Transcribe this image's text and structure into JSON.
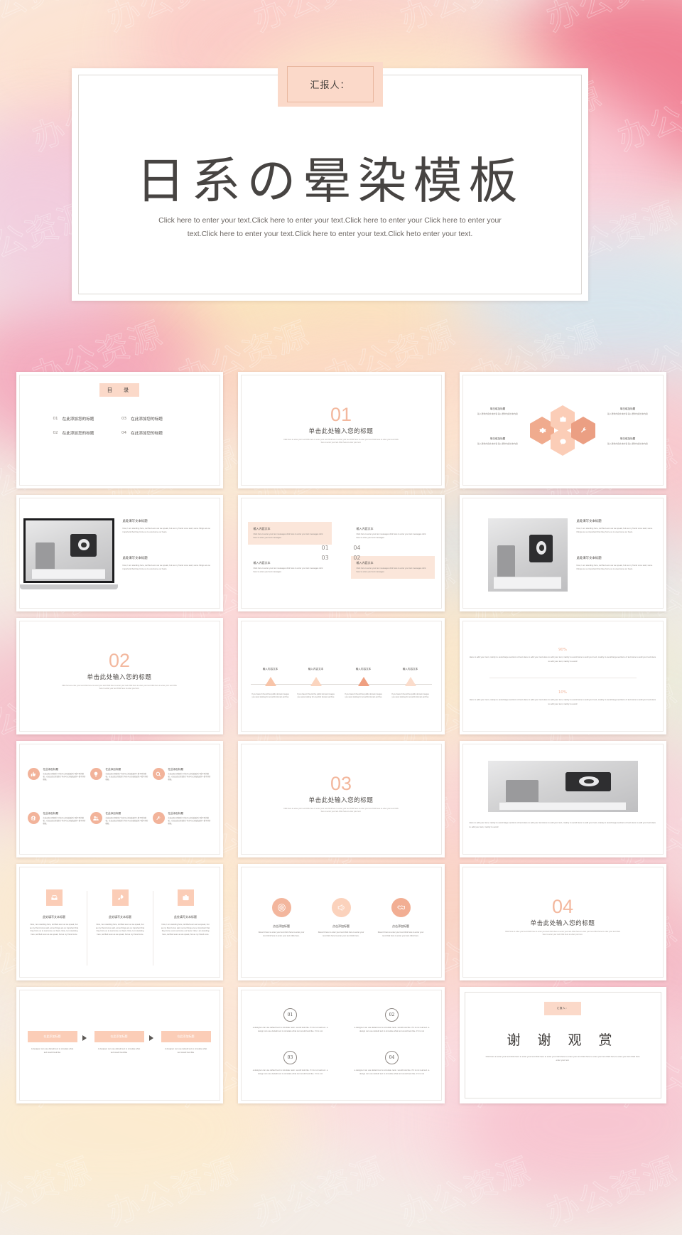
{
  "theme": {
    "accent": "#f0b49a",
    "accent_deep": "#eb9f83",
    "accent_soft": "#fbcdb7",
    "accent_pale": "#fbe6da",
    "badge_bg": "#fbd9c9",
    "text_dark": "#4c4845",
    "text_mid": "#8a8480",
    "slide_bg": "#ffffff"
  },
  "watermark": {
    "glyph": "办公资源"
  },
  "hero": {
    "badge": "汇报人：",
    "title": "日系の晕染模板",
    "subtitle": "Click here to enter your text.Click here to enter your text.Click here to enter your Click here to enter your text.Click here to enter your text.Click here to enter your text.Click heto enter your text."
  },
  "slides": {
    "toc": {
      "badge": "目　录",
      "items": [
        {
          "num": "01",
          "title": "在此添加您的标题"
        },
        {
          "num": "03",
          "title": "在此添加您的标题"
        },
        {
          "num": "02",
          "title": "在此添加您的标题"
        },
        {
          "num": "04",
          "title": "在此添加您的标题"
        }
      ]
    },
    "section_1": {
      "num": "01",
      "title": "单击此处输入您的标题",
      "desc": "Click here to enter your text.Click here to enter your text.Click here to enter your text.Click here to enter your text.Click here to enter your text.Click here to enter your text.Click here to enter your text."
    },
    "section_2": {
      "num": "02",
      "title": "单击此处输入您的标题",
      "desc": "Click here to enter your text.Click here to enter your text.Click here to enter your text.Click here to enter your text.Click here to enter your text.Click here to enter your text.Click here to enter your text."
    },
    "section_3": {
      "num": "03",
      "title": "单击此处输入您的标题",
      "desc": "Click here to enter your text.Click here to enter your text.Click here to enter your text.Click here to enter your text.Click here to enter your text.Click here to enter your text.Click here to enter your text."
    },
    "section_4": {
      "num": "04",
      "title": "单击此处输入您的标题",
      "desc": "Click here to enter your text.Click here to enter your text.Click here to enter your text.Click here to enter your text.Click here to enter your text.Click here to enter your text.Click here to enter your text."
    },
    "hexagon": {
      "labels": [
        {
          "title": "单击填加标题",
          "body": "输入整体内容文本内容 输入整体内容文本内容"
        },
        {
          "title": "单击填加标题",
          "body": "输入整体内容文本内容 输入整体内容文本内容"
        },
        {
          "title": "单击填加标题",
          "body": "输入整体内容文本内容 输入整体内容文本内容"
        },
        {
          "title": "单击填加标题",
          "body": "输入整体内容文本内容 输入整体内容文本内容"
        }
      ],
      "icons": [
        "briefcase-icon",
        "gear-icon",
        "wrench-icon",
        "chat-icon"
      ]
    },
    "laptop_photo": {
      "blocks": [
        {
          "title": "此处填写文本标题",
          "body": "Now, I am standing here, terrified even as we speak, but as my friend once said, some things are so important that they force us to overcome our fears."
        },
        {
          "title": "此处填写文本标题",
          "body": "Now, I am standing here, terrified even as we speak, but as my friend once said, some things are so important that they force us to overcome our fears."
        }
      ]
    },
    "camera_photo": {
      "blocks": [
        {
          "title": "此处填写文本标题",
          "body": "Now, I am standing here, terrified even as we speak, but as my friend once said, some things are so important that they force us to overcome our fears."
        },
        {
          "title": "此处填写文本标题",
          "body": "Now, I am standing here, terrified even as we speak, but as my friend once said, some things are so important that they force us to overcome our fears."
        }
      ]
    },
    "quadrants": {
      "items": [
        {
          "num": "01",
          "title": "输入内容文本",
          "body": "Click here to enter your text messages click here to enter your text messages click here to enter your text messages"
        },
        {
          "num": "04",
          "title": "输入内容文本",
          "body": "Click here to enter your text messages click here to enter your text messages click here to enter your text messages"
        },
        {
          "num": "03",
          "title": "输入内容文本",
          "body": "Click here to enter your text messages click here to enter your text messages click here to enter your text messages"
        },
        {
          "num": "02",
          "title": "输入内容文本",
          "body": "Click here to enter your text messages click here to enter your text messages click here to enter your text messages"
        }
      ]
    },
    "timeline": {
      "items": [
        {
          "title": "输入内容文本",
          "body": "If you haven't found the public domain images you were looking for at public domain archive"
        },
        {
          "title": "输入内容文本",
          "body": "If you haven't found the public domain images you were looking for at public domain archive"
        },
        {
          "title": "输入内容文本",
          "body": "If you haven't found the public domain images you were looking for at public domain archive"
        },
        {
          "title": "输入内容文本",
          "body": "If you haven't found the public domain images you were looking for at public domain archive"
        }
      ]
    },
    "percent": {
      "rows": [
        {
          "value": "90%",
          "body": "Here to add your text, mainly to avoid large sections of text.Here to add your text.Here to add your text, mainly to avoid Here to add your text, mainly to avoid large sections of text.Here to add your text.Here to add your text, mainly to avoid"
        },
        {
          "value": "10%",
          "body": "Here to add your text, mainly to avoid large sections of text.Here to add your text.Here to add your text, mainly to avoid Here to add your text, mainly to avoid large sections of text.Here to add your text.Here to add your text, mainly to avoid"
        }
      ]
    },
    "icon_grid": {
      "items": [
        {
          "icon": "thumbs-up-icon",
          "title": "在此添加标题",
          "body": "在这边您已经复制了内容可以添加粘贴到人看不到的模板。在这边您已经复制了内容可以添加粘贴到人看不到的模板。"
        },
        {
          "icon": "lightbulb-icon",
          "title": "在此添加标题",
          "body": "在这边您已经复制了内容可以添加粘贴到人看不到的模板。在这边您已经复制了内容可以添加粘贴到人看不到的模板。"
        },
        {
          "icon": "search-icon",
          "title": "在此添加标题",
          "body": "在这边您已经复制了内容可以添加粘贴到人看不到的模板。在这边您已经复制了内容可以添加粘贴到人看不到的模板。"
        },
        {
          "icon": "globe-icon",
          "title": "在此添加标题",
          "body": "在这边您已经复制了内容可以添加粘贴到人看不到的模板。在这边您已经复制了内容可以添加粘贴到人看不到的模板。"
        },
        {
          "icon": "people-icon",
          "title": "在此添加标题",
          "body": "在这边您已经复制了内容可以添加粘贴到人看不到的模板。在这边您已经复制了内容可以添加粘贴到人看不到的模板。"
        },
        {
          "icon": "wrench-icon",
          "title": "在此添加标题",
          "body": "在这边您已经复制了内容可以添加粘贴到人看不到的模板。在这边您已经复制了内容可以添加粘贴到人看不到的模板。"
        }
      ]
    },
    "wide_photo": {
      "caption": "Here to add your text, mainly to avoid large sections of text.Here to add your text.Here to add your text, mainly to avoid Here to add your text, mainly to avoid large sections of text.Here to add your text.Here to add your text, mainly to avoid"
    },
    "three_column": {
      "items": [
        {
          "icon": "inbox-icon",
          "title": "此处填写文本标题",
          "body": "Now, I am standing here, terrified even as we speak, but as my friend once said, some things are so important that they force us to overcome our fears. Now, I am standing here, terrified even as we speak, but as my friend once"
        },
        {
          "icon": "rocket-icon",
          "title": "此处填写文本标题",
          "body": "Now, I am standing here, terrified even as we speak, but as my friend once said, some things are so important that they force us to overcome our fears. Now, I am standing here, terrified even as we speak, but as my friend once"
        },
        {
          "icon": "briefcase-icon",
          "title": "此处填写文本标题",
          "body": "Now, I am standing here, terrified even as we speak, but as my friend once said, some things are so important that they force us to overcome our fears. Now, I am standing here, terrified even as we speak, but as my friend once"
        }
      ]
    },
    "three_circle": {
      "items": [
        {
          "icon": "target-icon",
          "title": "点击添加标题",
          "body": "Doesn't here to enter your text.Click here to enter your text.Click here to enter your text.Click here."
        },
        {
          "icon": "megaphone-icon",
          "title": "点击添加标题",
          "body": "Doesn't here to enter your text.Click here to enter your text.Click here to enter your text.Click here."
        },
        {
          "icon": "handshake-icon",
          "title": "点击添加标题",
          "body": "Doesn't here to enter your text.Click here to enter your text.Click here to enter your text.Click here."
        }
      ]
    },
    "arrow_flow": {
      "items": [
        {
          "title": "在此添加标题",
          "body": "A designer can use default text to simulate what text would look like"
        },
        {
          "title": "在此添加标题",
          "body": "A designer can use default text to simulate what text would look like"
        },
        {
          "title": "在此添加标题",
          "body": "A designer can use default text to simulate what text would look like"
        }
      ]
    },
    "numbered": {
      "items": [
        {
          "num": "01",
          "body": "a designer can use default text to simulate nann. would look like. if it is not real text. a design can use default text to simulate what text would look like. if it is not"
        },
        {
          "num": "02",
          "body": "a designer can use default text to simulate nann. would look like. if it is not real text. a design can use default text to simulate what text would look like. if it is not"
        },
        {
          "num": "03",
          "body": "a designer can use default text to simulate nann. would look like. if it is not real text. a design can use default text to simulate what text would look like. if it is not"
        },
        {
          "num": "04",
          "body": "a designer can use default text to simulate nann. would look like. if it is not real text. a design can use default text to simulate what text would look like. if it is not"
        }
      ]
    },
    "thanks": {
      "badge": "汇报人：",
      "title": "谢 谢 观 赏",
      "body": "Click here to enter your text.Click here to enter your text.Click here to enter your Click here to enter your text.Click here to enter your text.Click here to enter your text.Click heto enter your text."
    }
  }
}
